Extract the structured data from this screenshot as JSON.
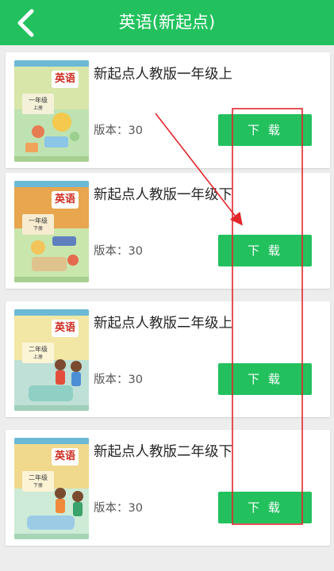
{
  "header": {
    "title": "英语(新起点)",
    "back_icon": "chevron-left-icon"
  },
  "colors": {
    "accent": "#22c15e",
    "annotation": "#e3262b",
    "background": "#ededed"
  },
  "books": [
    {
      "name": "新起点人教版一年级上",
      "version": "版本：30",
      "download_label": "下 载",
      "cover": {
        "title": "英语",
        "grade": "一年级",
        "vol": "上册",
        "top_color": "#d8e7a9",
        "bottom_color": "#bfe2b2"
      }
    },
    {
      "name": "新起点人教版一年级下",
      "version": "版本：30",
      "download_label": "下 载",
      "cover": {
        "title": "英语",
        "grade": "一年级",
        "vol": "下册",
        "top_color": "#e8a64f",
        "bottom_color": "#c9e6ad"
      }
    },
    {
      "name": "新起点人教版二年级上",
      "version": "版本：30",
      "download_label": "下 载",
      "cover": {
        "title": "英语",
        "grade": "二年级",
        "vol": "上册",
        "top_color": "#f2e7a5",
        "bottom_color": "#bfe0d6"
      }
    },
    {
      "name": "新起点人教版二年级下",
      "version": "版本：30",
      "download_label": "下 载",
      "cover": {
        "title": "英语",
        "grade": "二年级",
        "vol": "下册",
        "top_color": "#f0d98c",
        "bottom_color": "#cdebd6"
      }
    }
  ]
}
